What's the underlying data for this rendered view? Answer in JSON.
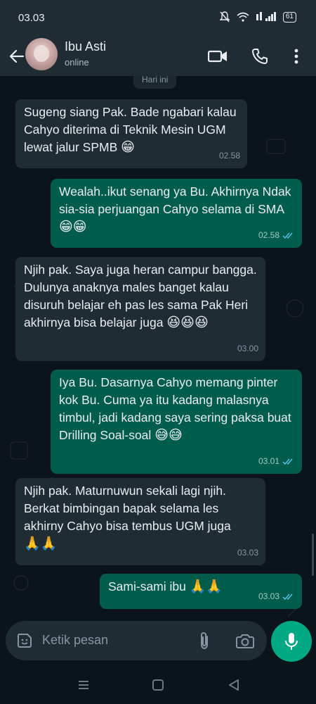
{
  "status_bar": {
    "time": "03.03",
    "battery": "61"
  },
  "header": {
    "contact_name": "Ibu Asti",
    "contact_status": "online"
  },
  "chat": {
    "date_chip": "Hari ini",
    "messages": [
      {
        "direction": "in",
        "text": "Sugeng siang Pak. Bade ngabari kalau Cahyo diterima di Teknik Mesin UGM lewat jalur SPMB",
        "emoji": "😁",
        "time": "02.58"
      },
      {
        "direction": "out",
        "text": "Wealah..ikut senang ya Bu. Akhirnya Ndak sia-sia perjuangan Cahyo selama di SMA",
        "emoji": "😁😁",
        "time": "02.58",
        "read": true
      },
      {
        "direction": "in",
        "text": "Njih pak. Saya juga heran campur bangga. Dulunya anaknya males banget kalau disuruh belajar eh pas les sama Pak Heri akhirnya bisa belajar juga",
        "emoji": "😆😆😆",
        "time": "03.00"
      },
      {
        "direction": "out",
        "text": "Iya Bu. Dasarnya Cahyo memang pinter kok Bu. Cuma ya itu kadang malasnya timbul, jadi kadang saya sering paksa buat Drilling Soal-soal",
        "emoji": "😅😅",
        "time": "03.01",
        "read": true
      },
      {
        "direction": "in",
        "text": "Njih pak. Maturnuwun sekali lagi njih. Berkat bimbingan bapak selama les akhirny Cahyo bisa tembus UGM juga",
        "emoji": "🙏🙏",
        "time": "03.03"
      },
      {
        "direction": "out",
        "text": "Sami-sami ibu",
        "emoji": "🙏🙏",
        "time": "03.03",
        "read": true
      }
    ]
  },
  "composer": {
    "placeholder": "Ketik pesan"
  },
  "colors": {
    "header_bg": "#1f2c33",
    "incoming_bubble": "#1f2c34",
    "outgoing_bubble": "#005c4b",
    "accent": "#00a884",
    "read_ticks": "#53bdeb"
  },
  "icons": [
    "back-arrow-icon",
    "video-call-icon",
    "voice-call-icon",
    "more-menu-icon",
    "sticker-icon",
    "attach-icon",
    "camera-icon",
    "mic-icon"
  ]
}
